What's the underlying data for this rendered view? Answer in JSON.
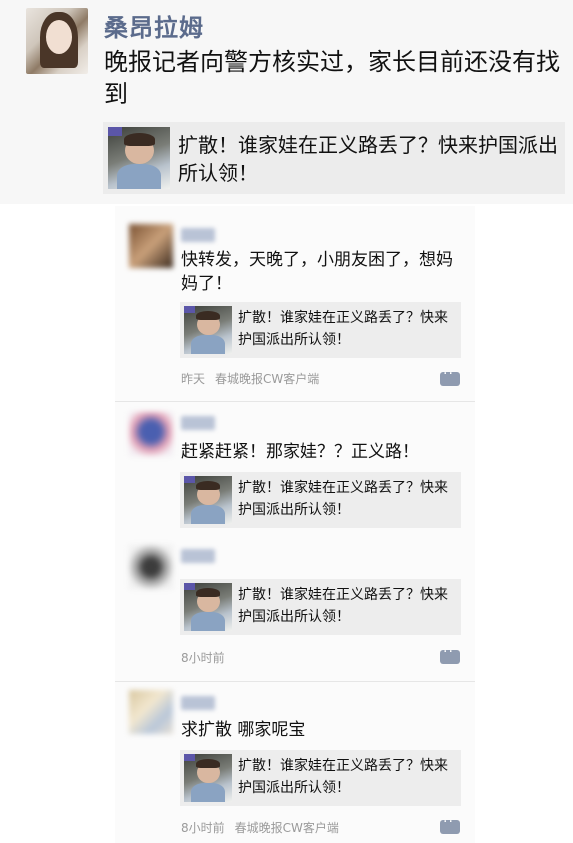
{
  "post": {
    "author": "桑昂拉姆",
    "text": "晚报记者向警方核实过，家长目前还没有找到",
    "shared": {
      "title": "扩散！谁家娃在正义路丢了？快来护国派出所认领！"
    }
  },
  "comments": [
    {
      "text": "快转发，天晚了，小朋友困了，想妈妈了！",
      "shared_title": "扩散！谁家娃在正义路丢了？快来护国派出所认领！",
      "time": "昨天",
      "source": "春城晚报CW客户端"
    },
    {
      "text": "赶紧赶紧！那家娃？？正义路！",
      "shared_title": "扩散！谁家娃在正义路丢了？快来护国派出所认领！",
      "time": "",
      "source": ""
    },
    {
      "text": "",
      "shared_title": "扩散！谁家娃在正义路丢了？快来护国派出所认领！",
      "time": "8小时前",
      "source": ""
    },
    {
      "text": "求扩散 哪家呢宝",
      "shared_title": "扩散！谁家娃在正义路丢了？快来护国派出所认领！",
      "time": "8小时前",
      "source": "春城晚报CW客户端"
    }
  ],
  "colors": {
    "author_name": "#5b6b8c",
    "card_bg": "#ececec",
    "meta": "#9a9a9a"
  }
}
